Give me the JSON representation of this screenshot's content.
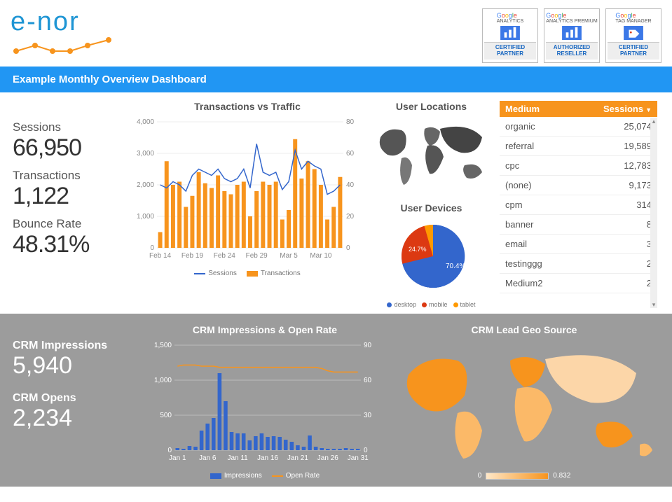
{
  "header": {
    "logo_text": "e-nor",
    "badges": [
      {
        "brand": "Google",
        "sub": "ANALYTICS",
        "label_l1": "CERTIFIED",
        "label_l2": "PARTNER",
        "icon": "bar"
      },
      {
        "brand": "Google",
        "sub": "ANALYTICS PREMIUM",
        "label_l1": "AUTHORIZED",
        "label_l2": "RESELLER",
        "icon": "bar"
      },
      {
        "brand": "Google",
        "sub": "TAG MANAGER",
        "label_l1": "CERTIFIED",
        "label_l2": "PARTNER",
        "icon": "tag"
      }
    ]
  },
  "titlebar": "Example Monthly Overview Dashboard",
  "kpis": {
    "sessions_label": "Sessions",
    "sessions_value": "66,950",
    "transactions_label": "Transactions",
    "transactions_value": "1,122",
    "bounce_label": "Bounce Rate",
    "bounce_value": "48.31%"
  },
  "combo": {
    "title": "Transactions vs Traffic",
    "legend_sessions": "Sessions",
    "legend_transactions": "Transactions"
  },
  "geo": {
    "title": "User Locations"
  },
  "pie": {
    "title": "User Devices",
    "desktop": "desktop",
    "mobile": "mobile",
    "tablet": "tablet",
    "desktop_pct": "70.4%",
    "mobile_pct": "24.7%"
  },
  "table": {
    "col1": "Medium",
    "col2": "Sessions",
    "rows": [
      {
        "m": "organic",
        "s": "25,074"
      },
      {
        "m": "referral",
        "s": "19,589"
      },
      {
        "m": "cpc",
        "s": "12,783"
      },
      {
        "m": "(none)",
        "s": "9,173"
      },
      {
        "m": "cpm",
        "s": "314"
      },
      {
        "m": "banner",
        "s": "8"
      },
      {
        "m": "email",
        "s": "3"
      },
      {
        "m": "testinggg",
        "s": "2"
      },
      {
        "m": "Medium2",
        "s": "2"
      }
    ]
  },
  "kpis2": {
    "imp_label": "CRM Impressions",
    "imp_value": "5,940",
    "opens_label": "CRM Opens",
    "opens_value": "2,234"
  },
  "crm": {
    "title": "CRM Impressions & Open Rate",
    "legend_imp": "Impressions",
    "legend_open": "Open Rate"
  },
  "geo2": {
    "title": "CRM Lead Geo Source",
    "min": "0",
    "max": "0.832"
  },
  "chart_data": {
    "transactions_vs_traffic": {
      "type": "combo",
      "title": "Transactions vs Traffic",
      "x_categories": [
        "Feb 14",
        "Feb 15",
        "Feb 16",
        "Feb 17",
        "Feb 18",
        "Feb 19",
        "Feb 20",
        "Feb 21",
        "Feb 22",
        "Feb 23",
        "Feb 24",
        "Feb 25",
        "Feb 26",
        "Feb 27",
        "Feb 28",
        "Feb 29",
        "Mar 1",
        "Mar 2",
        "Mar 3",
        "Mar 4",
        "Mar 5",
        "Mar 6",
        "Mar 7",
        "Mar 8",
        "Mar 9",
        "Mar 10",
        "Mar 11",
        "Mar 12",
        "Mar 13"
      ],
      "x_tick_labels": [
        "Feb 14",
        "Feb 19",
        "Feb 24",
        "Feb 29",
        "Mar 5",
        "Mar 10"
      ],
      "series": [
        {
          "name": "Sessions",
          "type": "line",
          "axis": "left",
          "values": [
            2000,
            1900,
            2100,
            2000,
            1800,
            2300,
            2500,
            2400,
            2300,
            2500,
            2200,
            2100,
            2200,
            2500,
            1900,
            3300,
            2400,
            2300,
            2400,
            1850,
            2100,
            3100,
            2500,
            2750,
            2600,
            2500,
            1700,
            1800,
            2000
          ]
        },
        {
          "name": "Transactions",
          "type": "bar",
          "axis": "right",
          "values": [
            10,
            55,
            40,
            42,
            26,
            33,
            48,
            41,
            38,
            46,
            36,
            34,
            40,
            42,
            20,
            36,
            42,
            40,
            42,
            18,
            24,
            69,
            44,
            55,
            50,
            40,
            18,
            26,
            45
          ]
        }
      ],
      "y_left": {
        "min": 0,
        "max": 4000,
        "ticks": [
          0,
          1000,
          2000,
          3000,
          4000
        ]
      },
      "y_right": {
        "min": 0,
        "max": 80,
        "ticks": [
          0,
          20,
          40,
          60,
          80
        ]
      }
    },
    "user_devices": {
      "type": "pie",
      "title": "User Devices",
      "slices": [
        {
          "name": "desktop",
          "value": 70.4,
          "color": "#3366cc"
        },
        {
          "name": "mobile",
          "value": 24.7,
          "color": "#dc3912"
        },
        {
          "name": "tablet",
          "value": 4.9,
          "color": "#ff9900"
        }
      ]
    },
    "medium_sessions_table": {
      "type": "table",
      "columns": [
        "Medium",
        "Sessions"
      ],
      "rows": [
        [
          "organic",
          25074
        ],
        [
          "referral",
          19589
        ],
        [
          "cpc",
          12783
        ],
        [
          "(none)",
          9173
        ],
        [
          "cpm",
          314
        ],
        [
          "banner",
          8
        ],
        [
          "email",
          3
        ],
        [
          "testinggg",
          2
        ],
        [
          "Medium2",
          2
        ]
      ]
    },
    "crm_impressions_open_rate": {
      "type": "combo",
      "title": "CRM Impressions & Open Rate",
      "x_categories": [
        "Jan 1",
        "Jan 2",
        "Jan 3",
        "Jan 4",
        "Jan 5",
        "Jan 6",
        "Jan 7",
        "Jan 8",
        "Jan 9",
        "Jan 10",
        "Jan 11",
        "Jan 12",
        "Jan 13",
        "Jan 14",
        "Jan 15",
        "Jan 16",
        "Jan 17",
        "Jan 18",
        "Jan 19",
        "Jan 20",
        "Jan 21",
        "Jan 22",
        "Jan 23",
        "Jan 24",
        "Jan 25",
        "Jan 26",
        "Jan 27",
        "Jan 28",
        "Jan 29",
        "Jan 30",
        "Jan 31"
      ],
      "x_tick_labels": [
        "Jan 1",
        "Jan 6",
        "Jan 11",
        "Jan 16",
        "Jan 21",
        "Jan 26",
        "Jan 31"
      ],
      "series": [
        {
          "name": "Impressions",
          "type": "bar",
          "axis": "left",
          "values": [
            30,
            20,
            60,
            50,
            280,
            380,
            460,
            1100,
            700,
            260,
            240,
            240,
            140,
            200,
            240,
            190,
            200,
            190,
            150,
            120,
            70,
            50,
            210,
            50,
            30,
            20,
            20,
            20,
            30,
            20,
            20
          ]
        },
        {
          "name": "Open Rate",
          "type": "line",
          "axis": "right",
          "values": [
            72,
            73,
            73,
            73,
            72,
            72,
            72,
            71,
            71,
            71,
            71,
            71,
            71,
            71,
            71,
            71,
            71,
            71,
            71,
            71,
            71,
            71,
            71,
            71,
            70,
            68,
            67,
            67,
            67,
            67,
            67
          ]
        }
      ],
      "y_left": {
        "min": 0,
        "max": 1500,
        "ticks": [
          0,
          500,
          1000,
          1500
        ]
      },
      "y_right": {
        "min": 0,
        "max": 90,
        "ticks": [
          0,
          30,
          60,
          90
        ]
      }
    },
    "user_locations": {
      "type": "geo",
      "title": "User Locations"
    },
    "crm_lead_geo_source": {
      "type": "geo",
      "title": "CRM Lead Geo Source",
      "scale": [
        0,
        0.832
      ]
    }
  }
}
